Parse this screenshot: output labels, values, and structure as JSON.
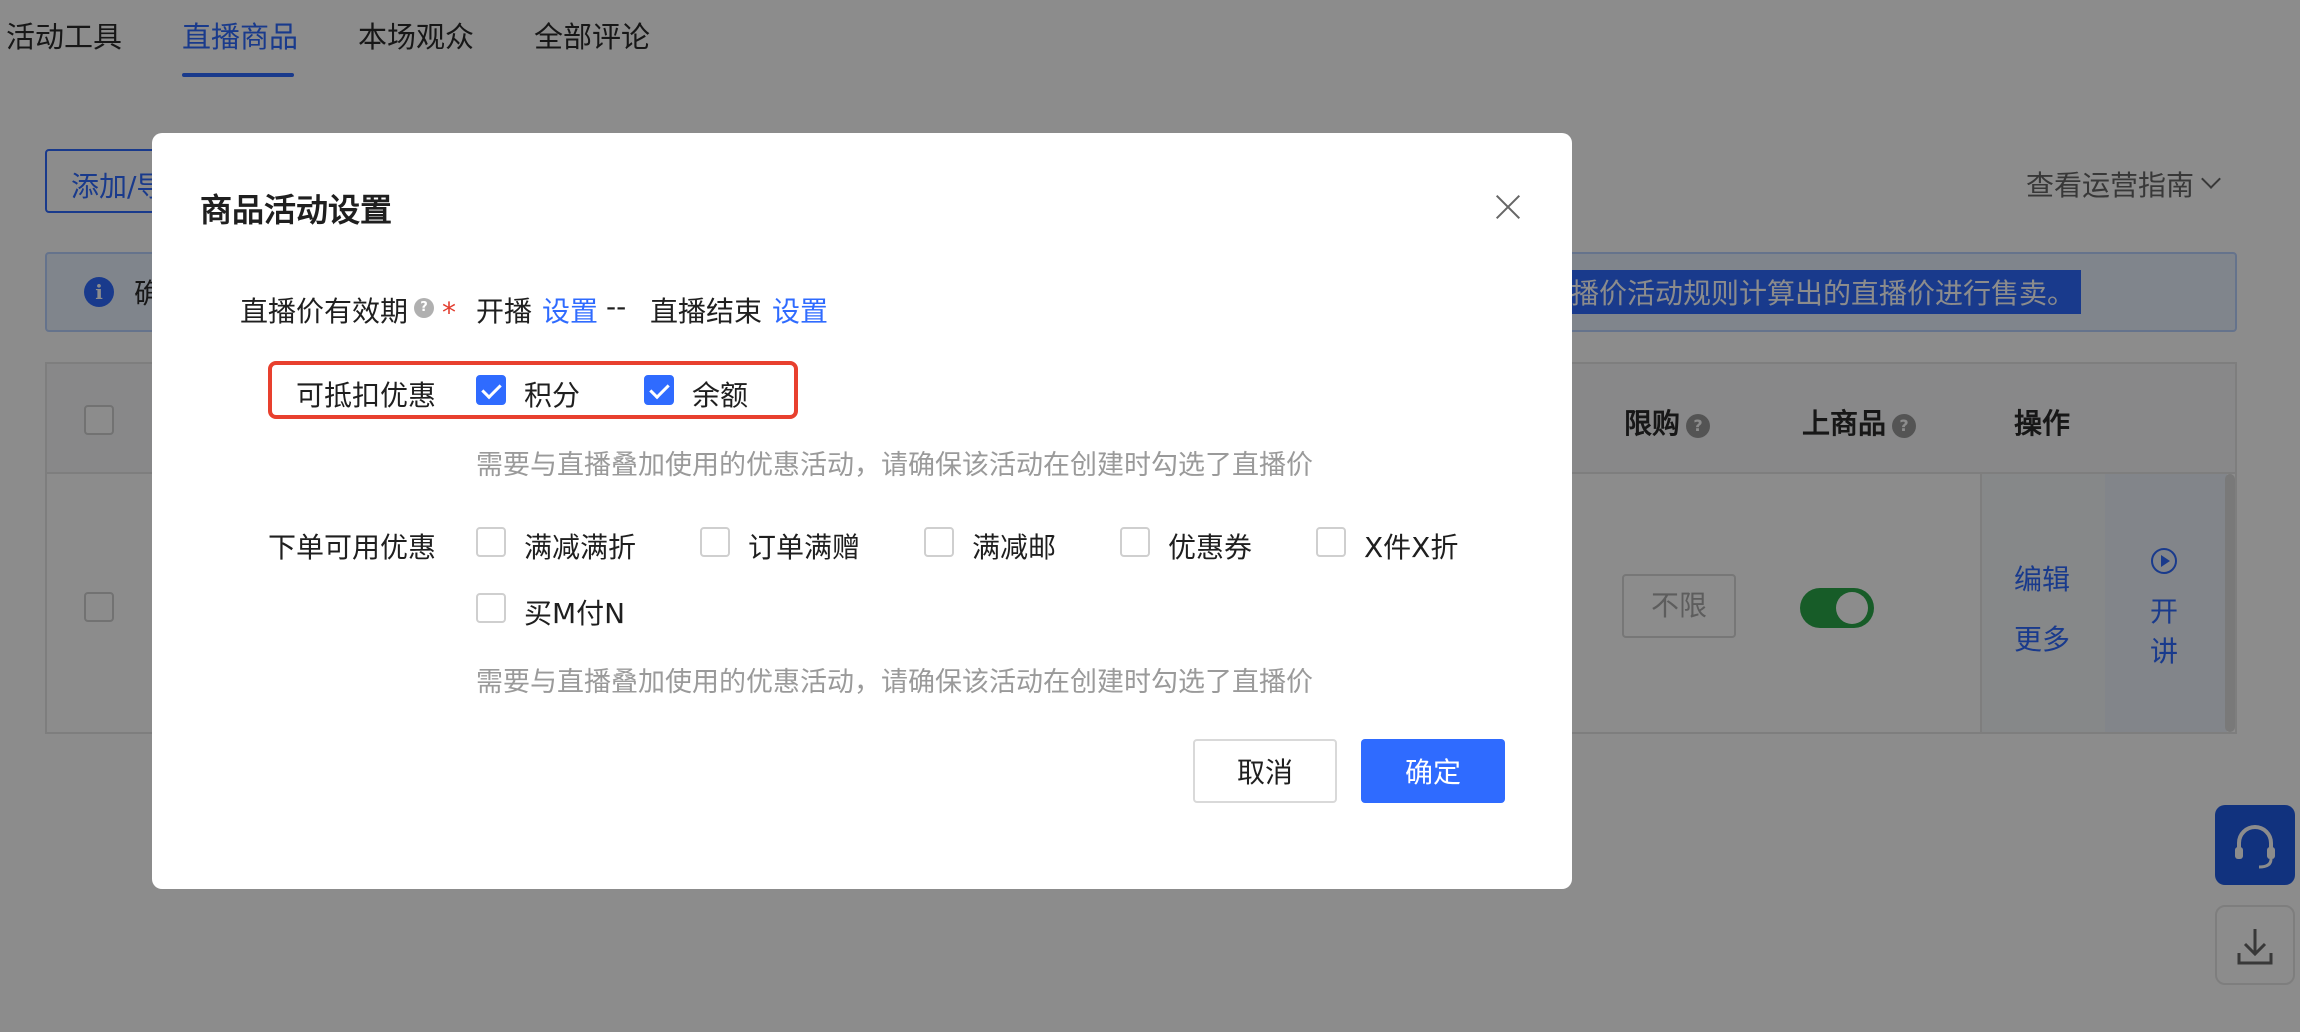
{
  "tabs": [
    {
      "label": "活动工具",
      "active": false
    },
    {
      "label": "直播商品",
      "active": true
    },
    {
      "label": "本场观众",
      "active": false
    },
    {
      "label": "全部评论",
      "active": false
    }
  ],
  "toolbar": {
    "add_button_label": "添加/导",
    "guide_label": "查看运营指南"
  },
  "notice": {
    "icon": "info-icon",
    "left_text": "确",
    "right_text": "播价活动规则计算出的直播价进行售卖。"
  },
  "table": {
    "columns": {
      "limit": "限购",
      "on_shelf": "上商品",
      "ops": "操作"
    },
    "row": {
      "limit_value": "不限",
      "edit_label": "编辑",
      "more_label": "更多",
      "lecture_label_1": "开",
      "lecture_label_2": "讲"
    }
  },
  "modal": {
    "title": "商品活动设置",
    "validity": {
      "label": "直播价有效期",
      "required_mark": "*",
      "start_text": "开播",
      "start_link": "设置",
      "separator": "--",
      "end_text": "直播结束",
      "end_link": "设置"
    },
    "deductible": {
      "label": "可抵扣优惠",
      "options": [
        {
          "label": "积分",
          "checked": true
        },
        {
          "label": "余额",
          "checked": true
        }
      ],
      "hint": "需要与直播叠加使用的优惠活动，请确保该活动在创建时勾选了直播价"
    },
    "order_discounts": {
      "label": "下单可用优惠",
      "options": [
        {
          "label": "满减满折",
          "checked": false
        },
        {
          "label": "订单满赠",
          "checked": false
        },
        {
          "label": "满减邮",
          "checked": false
        },
        {
          "label": "优惠券",
          "checked": false
        },
        {
          "label": "X件X折",
          "checked": false
        },
        {
          "label": "买M付N",
          "checked": false
        }
      ],
      "hint": "需要与直播叠加使用的优惠活动，请确保该活动在创建时勾选了直播价"
    },
    "cancel_label": "取消",
    "ok_label": "确定"
  },
  "colors": {
    "accent": "#2f6bff",
    "highlight_border": "#e8402e",
    "toggle_on": "#2aa84a"
  }
}
